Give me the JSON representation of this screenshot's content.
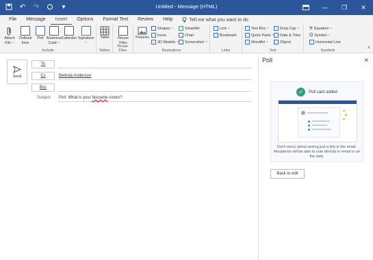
{
  "window": {
    "title": "Untitled - Message (HTML)",
    "accent": "#2b579a",
    "quick_access_icons": [
      "save-icon",
      "undo-icon",
      "redo-icon",
      "format-icon",
      "customize-icon"
    ],
    "controls": [
      "ribbon-display-icon",
      "minimize-icon",
      "restore-icon",
      "close-icon"
    ]
  },
  "tabs": {
    "items": [
      "File",
      "Message",
      "Insert",
      "Options",
      "Format Text",
      "Review",
      "Help"
    ],
    "active": "Insert",
    "tell_me": "Tell me what you want to do"
  },
  "ribbon": {
    "include": {
      "label": "Include",
      "buttons": [
        "Attach File ~",
        "Outlook Item",
        "Poll",
        "Business Card ~",
        "Calendar",
        "Signature ~"
      ]
    },
    "tables": {
      "label": "Tables",
      "button": "Table"
    },
    "reuse": {
      "label": "Reuse Files",
      "button": "Reuse Files"
    },
    "illustrations": {
      "label": "Illustrations",
      "pictures": "Pictures",
      "small": [
        "Shapes ~",
        "Icons",
        "3D Models ~",
        "SmartArt",
        "Chart",
        "Screenshot ~"
      ]
    },
    "links": {
      "label": "Links",
      "small": [
        "Link ~",
        "Bookmark"
      ]
    },
    "text": {
      "label": "Text",
      "small": [
        "Text Box ~",
        "Quick Parts ~",
        "WordArt ~",
        "Drop Cap ~",
        "Date & Time",
        "Object"
      ]
    },
    "symbols": {
      "label": "Symbols",
      "small": [
        "Equation ~",
        "Symbol ~",
        "Horizontal Line"
      ]
    }
  },
  "compose": {
    "send": "Send",
    "to_label": "To",
    "cc_label": "Cc",
    "bcc_label": "Bcc",
    "to_value": "",
    "cc_value": "Belinda Anderson",
    "bcc_value": "",
    "subject_label": "Subject",
    "subject_prefix": "Poll:",
    "subject_mid": " What is your ",
    "subject_flag": "favourite",
    "subject_end": " colour?"
  },
  "poll": {
    "title": "Poll",
    "added": "Poll card added",
    "note": "Don't worry about seeing just a link in the email. Recipients will be able to vote directly in email or on the web.",
    "back": "Back to edit"
  }
}
